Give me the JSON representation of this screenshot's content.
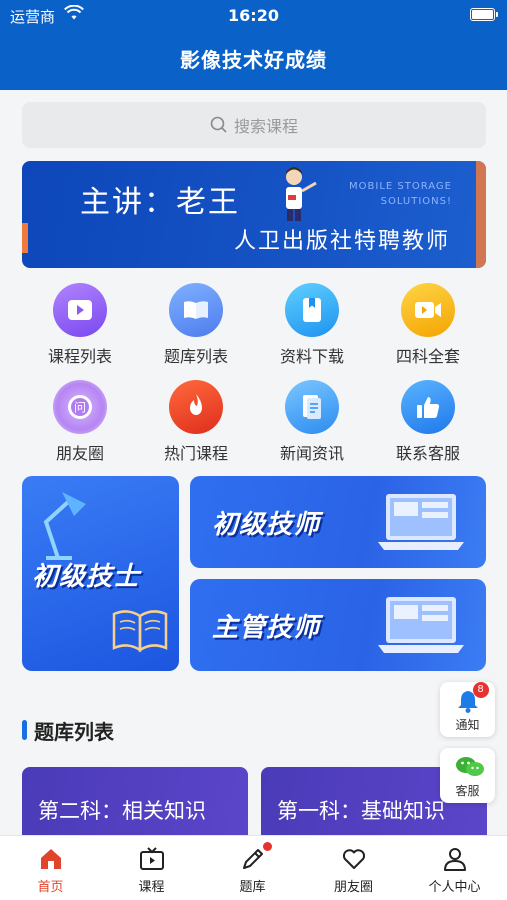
{
  "status_bar": {
    "carrier": "运营商",
    "time": "16:20"
  },
  "header": {
    "title": "影像技术好成绩"
  },
  "search": {
    "placeholder": "搜索课程"
  },
  "banner": {
    "lecturer": "主讲：老王",
    "tagline_1": "MOBILE STORAGE",
    "tagline_2": "SOLUTIONS!",
    "subtitle": "人卫出版社特聘教师"
  },
  "menu": [
    {
      "label": "课程列表",
      "icon": "play-icon",
      "color": "#8a5cf5"
    },
    {
      "label": "题库列表",
      "icon": "book-icon",
      "color": "#5b8ff5"
    },
    {
      "label": "资料下载",
      "icon": "bookmark-icon",
      "color": "#2fa8f5"
    },
    {
      "label": "四科全套",
      "icon": "video-icon",
      "color": "#f5b21c"
    },
    {
      "label": "朋友圈",
      "icon": "question-icon",
      "color": "#b985f2"
    },
    {
      "label": "热门课程",
      "icon": "fire-icon",
      "color": "#ec4b2c"
    },
    {
      "label": "新闻资讯",
      "icon": "document-icon",
      "color": "#3aa0f2"
    },
    {
      "label": "联系客服",
      "icon": "thumbs-up-icon",
      "color": "#2f8ff2"
    }
  ],
  "promos": {
    "left": "初级技士",
    "right_top": "初级技师",
    "right_bottom": "主管技师"
  },
  "section": {
    "title": "题库列表"
  },
  "question_banks": [
    {
      "label": "第二科：相关知识"
    },
    {
      "label": "第一科：基础知识"
    }
  ],
  "floating": {
    "notify_label": "通知",
    "notify_count": "8",
    "service_label": "客服"
  },
  "tabbar": [
    {
      "label": "首页",
      "icon": "home-icon",
      "active": true
    },
    {
      "label": "课程",
      "icon": "tv-icon",
      "active": false
    },
    {
      "label": "题库",
      "icon": "pencil-icon",
      "active": false
    },
    {
      "label": "朋友圈",
      "icon": "heart-icon",
      "active": false
    },
    {
      "label": "个人中心",
      "icon": "user-icon",
      "active": false
    }
  ],
  "colors": {
    "primary": "#0a62c9",
    "tab_active": "#e0452b",
    "badge": "#e8322f"
  }
}
